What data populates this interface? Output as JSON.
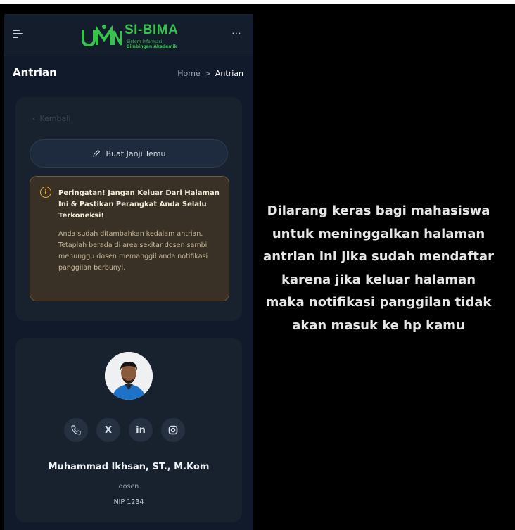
{
  "app": {
    "logo_title": "SI-BIMA",
    "logo_subtitle_1": "Sistem Informasi",
    "logo_subtitle_2": "Bimbingan Akademik",
    "brand_color": "#36c24b"
  },
  "header": {
    "page_title": "Antrian",
    "breadcrumb_home": "Home",
    "breadcrumb_separator": ">",
    "breadcrumb_current": "Antrian"
  },
  "queue_card": {
    "back_label": "Kembali",
    "appointment_button_label": "Buat Janji Temu",
    "warning": {
      "title": "Peringatan! Jangan Keluar Dari Halaman Ini & Pastikan Perangkat Anda Selalu Terkoneksi!",
      "body": "Anda sudah ditambahkan kedalam antrian. Tetaplah berada di area sekitar dosen sambil menunggu dosen memanggil anda notifikasi panggilan berbunyi."
    }
  },
  "lecturer": {
    "social_icons": [
      "phone-icon",
      "x-icon",
      "linkedin-icon",
      "instagram-icon"
    ],
    "social_glyphs": {
      "x": "X",
      "linkedin": "in"
    },
    "name": "Muhammad Ikhsan, ST., M.Kom",
    "role": "dosen",
    "nip": "NIP 1234"
  },
  "overlay_caption": {
    "lines": [
      "Dilarang keras bagi mahasiswa",
      "untuk meninggalkan halaman",
      "antrian ini jika sudah mendaftar",
      "karena jika keluar halaman",
      "maka notifikasi panggilan tidak",
      "akan masuk ke hp kamu"
    ]
  }
}
